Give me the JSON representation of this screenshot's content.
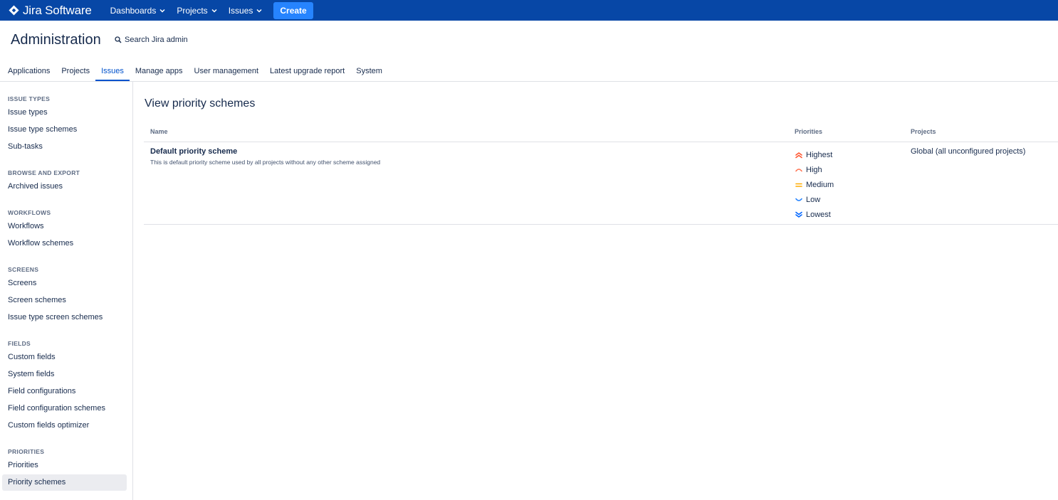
{
  "topbar": {
    "logo_text": "Jira Software",
    "nav": [
      {
        "label": "Dashboards",
        "icon": "chevron-down-icon"
      },
      {
        "label": "Projects",
        "icon": "chevron-down-icon"
      },
      {
        "label": "Issues",
        "icon": "chevron-down-icon"
      }
    ],
    "create_label": "Create",
    "colors": {
      "bar": "#0747a6",
      "create": "#2684ff"
    }
  },
  "header": {
    "title": "Administration",
    "search_label": "Search Jira admin"
  },
  "tabs": [
    {
      "label": "Applications",
      "active": false
    },
    {
      "label": "Projects",
      "active": false
    },
    {
      "label": "Issues",
      "active": true
    },
    {
      "label": "Manage apps",
      "active": false
    },
    {
      "label": "User management",
      "active": false
    },
    {
      "label": "Latest upgrade report",
      "active": false
    },
    {
      "label": "System",
      "active": false
    }
  ],
  "sidebar": {
    "sections": [
      {
        "title": "ISSUE TYPES",
        "items": [
          "Issue types",
          "Issue type schemes",
          "Sub-tasks"
        ]
      },
      {
        "title": "BROWSE AND EXPORT",
        "items": [
          "Archived issues"
        ]
      },
      {
        "title": "WORKFLOWS",
        "items": [
          "Workflows",
          "Workflow schemes"
        ]
      },
      {
        "title": "SCREENS",
        "items": [
          "Screens",
          "Screen schemes",
          "Issue type screen schemes"
        ]
      },
      {
        "title": "FIELDS",
        "items": [
          "Custom fields",
          "System fields",
          "Field configurations",
          "Field configuration schemes",
          "Custom fields optimizer"
        ]
      },
      {
        "title": "PRIORITIES",
        "items": [
          "Priorities",
          "Priority schemes"
        ]
      }
    ],
    "active_item": "Priority schemes"
  },
  "main": {
    "heading": "View priority schemes",
    "columns": {
      "name": "Name",
      "priorities": "Priorities",
      "projects": "Projects"
    },
    "rows": [
      {
        "name": "Default priority scheme",
        "description": "This is default priority scheme used by all projects without any other scheme assigned",
        "priorities": [
          {
            "label": "Highest",
            "icon": "priority-highest-icon",
            "color": "#ff5630"
          },
          {
            "label": "High",
            "icon": "priority-high-icon",
            "color": "#ff7452"
          },
          {
            "label": "Medium",
            "icon": "priority-medium-icon",
            "color": "#ffab00"
          },
          {
            "label": "Low",
            "icon": "priority-low-icon",
            "color": "#2684ff"
          },
          {
            "label": "Lowest",
            "icon": "priority-lowest-icon",
            "color": "#0065ff"
          }
        ],
        "projects": "Global (all unconfigured projects)"
      }
    ]
  }
}
